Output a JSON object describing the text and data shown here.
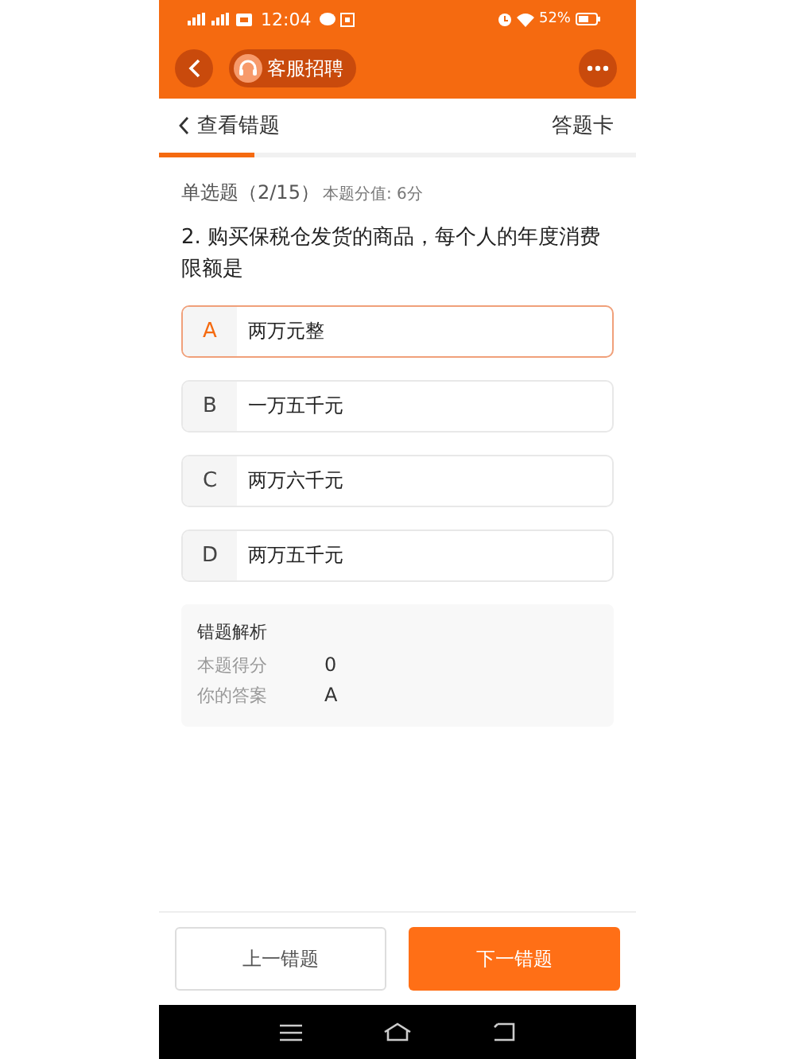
{
  "status_bar": {
    "time": "12:04",
    "battery": "52%"
  },
  "app_bar": {
    "title": "客服招聘"
  },
  "header": {
    "back_label": "查看错题",
    "answer_card": "答题卡"
  },
  "question": {
    "type": "单选题（2/15）",
    "score": "本题分值: 6分",
    "text": "2. 购买保税仓发货的商品，每个人的年度消费限额是"
  },
  "options": [
    {
      "letter": "A",
      "text": "两万元整",
      "selected": true
    },
    {
      "letter": "B",
      "text": "一万五千元",
      "selected": false
    },
    {
      "letter": "C",
      "text": "两万六千元",
      "selected": false
    },
    {
      "letter": "D",
      "text": "两万五千元",
      "selected": false
    }
  ],
  "analysis": {
    "title": "错题解析",
    "rows": [
      {
        "label": "本题得分",
        "value": "0"
      },
      {
        "label": "你的答案",
        "value": "A"
      }
    ]
  },
  "buttons": {
    "previous": "上一错题",
    "next": "下一错题"
  }
}
